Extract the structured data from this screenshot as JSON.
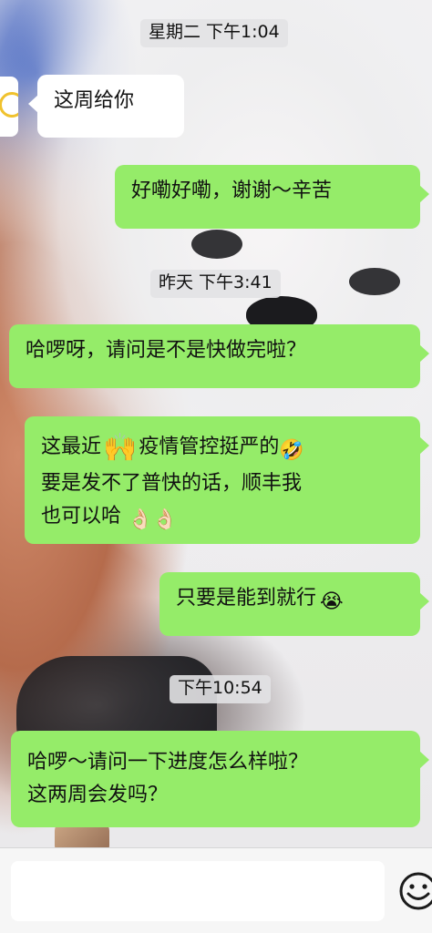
{
  "timestamps": [
    "星期二 下午1:04",
    "昨天 下午3:41",
    "下午10:54"
  ],
  "messages": [
    {
      "side": "left",
      "text": "这周给你"
    },
    {
      "side": "right",
      "text": "好嘞好嘞，谢谢～辛苦"
    },
    {
      "side": "right",
      "text": "哈啰呀，请问是不是快做完啦？"
    },
    {
      "side": "right",
      "lines": [
        "这最近",
        "疫情管控挺严的",
        "要是发不了普快的话，顺丰我",
        "也可以哈"
      ]
    },
    {
      "side": "right",
      "text": "只要是能到就行"
    },
    {
      "side": "right",
      "lines": [
        "哈啰～请问一下进度怎么样啦？",
        "这两周会发吗？"
      ]
    }
  ],
  "emojis": {
    "raised_hands": "🙌",
    "laugh_crying": "🤣",
    "ok_hand_1": "👌🏻",
    "ok_hand_2": "👌🏻",
    "crying": "😭"
  },
  "input": {
    "value": "",
    "placeholder": ""
  },
  "icons": {
    "emoji_button": "smiley-face-icon",
    "avatar": "avatar-logo"
  },
  "colors": {
    "sent_bubble": "#95ec69",
    "received_bubble": "#ffffff",
    "timestamp_bg": "#e2e2e4"
  }
}
